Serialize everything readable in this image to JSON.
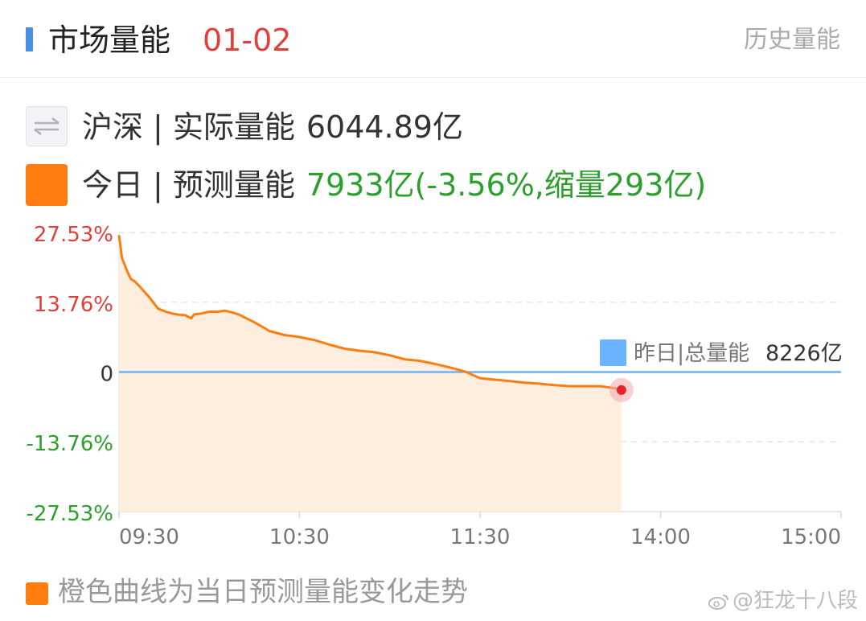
{
  "header": {
    "title": "市场量能",
    "date": "01-02",
    "history_link": "历史量能"
  },
  "actual": {
    "label": "沪深",
    "separator": "|",
    "metric": "实际量能",
    "value": "6044.89亿",
    "icon": "swap-arrows-icon"
  },
  "forecast": {
    "label": "今日",
    "separator": "|",
    "metric": "预测量能",
    "value": "7933亿(-3.56%,缩量293亿)",
    "color": "#ff7d0f"
  },
  "chart_data": {
    "type": "area",
    "y_tick_labels": [
      "27.53%",
      "13.76%",
      "0",
      "-13.76%",
      "-27.53%"
    ],
    "y_ticks": [
      27.53,
      13.76,
      0,
      -13.76,
      -27.53
    ],
    "ylim": [
      -27.53,
      27.53
    ],
    "x_tick_labels": [
      "09:30",
      "10:30",
      "11:30",
      "14:00",
      "15:00"
    ],
    "x_ticks_minutes": [
      0,
      60,
      120,
      180,
      240
    ],
    "xlim_minutes": [
      0,
      240
    ],
    "series": [
      {
        "name": "今日预测量能",
        "color": "#ff7d0f",
        "x_minutes": [
          0,
          1,
          2,
          3,
          4,
          5,
          7,
          10,
          13,
          16,
          18,
          20,
          22,
          24,
          25,
          27,
          30,
          33,
          35,
          36,
          38,
          40,
          42,
          45,
          48,
          50,
          55,
          60,
          65,
          70,
          75,
          80,
          85,
          90,
          95,
          100,
          105,
          110,
          115,
          118,
          120,
          125,
          130,
          135,
          140,
          145,
          150,
          155,
          160,
          165,
          167
        ],
        "y_percent": [
          27.0,
          22.5,
          21.0,
          19.5,
          18.3,
          18.0,
          16.8,
          14.8,
          12.5,
          11.8,
          11.5,
          11.3,
          11.2,
          10.6,
          11.4,
          11.5,
          11.9,
          11.9,
          12.1,
          12.0,
          11.7,
          11.3,
          10.7,
          9.8,
          8.8,
          8.1,
          7.3,
          6.9,
          6.3,
          5.4,
          4.6,
          4.2,
          3.9,
          3.3,
          2.5,
          2.2,
          1.6,
          0.9,
          0.1,
          -0.7,
          -1.2,
          -1.5,
          -1.8,
          -2.1,
          -2.3,
          -2.6,
          -2.8,
          -2.8,
          -2.8,
          -3.2,
          -3.56
        ]
      }
    ],
    "reference_line": {
      "label": "昨日|总量能",
      "value_label": "8226亿",
      "y_percent": 0,
      "color": "#6db1f6"
    }
  },
  "legend": {
    "text": "橙色曲线为当日预测量能变化走势"
  },
  "watermark": {
    "text": "@狂龙十八段"
  },
  "colors": {
    "accent": "#4a90e2",
    "red": "#e0403a",
    "green": "#2ca02c",
    "orange": "#ff7d0f",
    "fill": "#fdeee0",
    "baseline": "#6db1f6"
  }
}
